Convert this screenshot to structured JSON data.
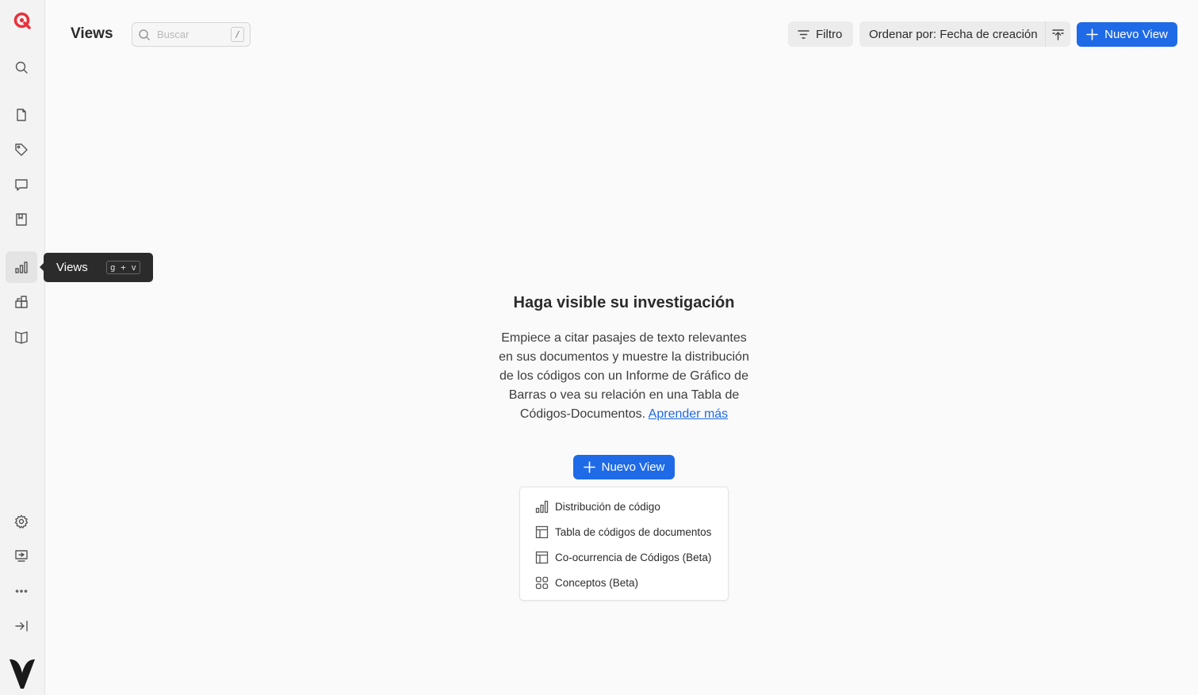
{
  "header": {
    "title": "Views",
    "search_placeholder": "Buscar",
    "search_shortcut": "/",
    "filter_label": "Filtro",
    "sort_label": "Ordenar por: Fecha de creación",
    "new_view_label": "Nuevo View"
  },
  "sidebar": {
    "tooltip_label": "Views",
    "tooltip_shortcut": "g + v",
    "active_item": "views"
  },
  "empty_state": {
    "title": "Haga visible su investigación",
    "description": "Empiece a citar pasajes de texto relevantes en sus documentos y muestre la distribución de los códigos con un Informe de Gráfico de Barras o vea su relación en una Tabla de Códigos-Documentos. ",
    "learn_more": "Aprender más",
    "new_view_label": "Nuevo View"
  },
  "menu": {
    "items": [
      {
        "label": "Distribución de código",
        "icon": "bar-chart-icon"
      },
      {
        "label": "Tabla de códigos de documentos",
        "icon": "table-icon"
      },
      {
        "label": "Co-ocurrencia de Códigos (Beta)",
        "icon": "table-icon"
      },
      {
        "label": "Conceptos (Beta)",
        "icon": "grid-icon"
      }
    ]
  },
  "colors": {
    "accent": "#1f6ae6",
    "logo": "#e8323c"
  }
}
